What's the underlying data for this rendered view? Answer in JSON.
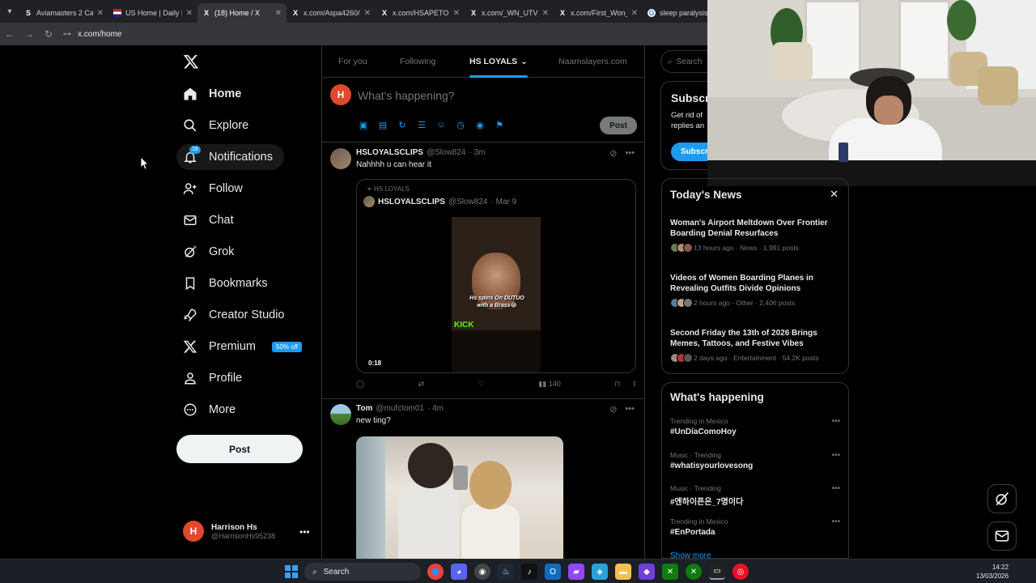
{
  "browser": {
    "tabs": [
      {
        "icon": "S",
        "title": "Aviamasters 2 Ca"
      },
      {
        "icon": "flag",
        "title": "US Home | Daily I"
      },
      {
        "icon": "X",
        "title": "(18) Home / X",
        "active": true
      },
      {
        "icon": "X",
        "title": "x.com/Aspa4260/"
      },
      {
        "icon": "X",
        "title": "x.com/HSAPETOI"
      },
      {
        "icon": "X",
        "title": "x.com/_WN_UTV_"
      },
      {
        "icon": "X",
        "title": "x.com/First_Won_"
      },
      {
        "icon": "G",
        "title": "sleep paralysis"
      }
    ],
    "url": "x.com/home"
  },
  "nav": {
    "items": [
      {
        "label": "Home",
        "icon": "home-icon"
      },
      {
        "label": "Explore",
        "icon": "search-icon"
      },
      {
        "label": "Notifications",
        "icon": "bell-icon",
        "badge": "18"
      },
      {
        "label": "Follow",
        "icon": "person-add-icon"
      },
      {
        "label": "Chat",
        "icon": "mail-icon"
      },
      {
        "label": "Grok",
        "icon": "grok-icon"
      },
      {
        "label": "Bookmarks",
        "icon": "bookmark-icon"
      },
      {
        "label": "Creator Studio",
        "icon": "rocket-icon"
      },
      {
        "label": "Premium",
        "icon": "x-icon",
        "promo": "50% off"
      },
      {
        "label": "Profile",
        "icon": "person-icon"
      },
      {
        "label": "More",
        "icon": "more-circle-icon"
      }
    ],
    "post_button": "Post",
    "account": {
      "name": "Harrison Hs",
      "handle": "@HarrisonHs95238",
      "initial": "H"
    }
  },
  "feed": {
    "tabs": [
      "For you",
      "Following",
      "HS LOYALS",
      "Naarnslayers.com"
    ],
    "active_tab": "HS LOYALS",
    "compose": {
      "placeholder": "What's happening?",
      "post_label": "Post",
      "initial": "H"
    },
    "tweets": [
      {
        "name": "HSLOYALSCLIPS",
        "handle": "@Slow824",
        "time": "· 3m",
        "text": "Nahhhh u can hear it",
        "quote": {
          "community": "HS LOYALS",
          "name": "HSLOYALSCLIPS",
          "handle": "@Slow824",
          "time": "· Mar 9",
          "video_caption": "Hs spins On DUTUO with a Brass😂",
          "video_brand": "KICK",
          "duration": "0:18"
        },
        "views": "140"
      },
      {
        "name": "Tom",
        "handle": "@mufctom01",
        "time": "· 4m",
        "text": "new ting?"
      }
    ]
  },
  "right": {
    "search_placeholder": "Search",
    "subscribe": {
      "title": "Subscri",
      "desc_line1": "Get rid of",
      "desc_line2": "replies an",
      "button": "Subscr"
    },
    "news": {
      "title": "Today's News",
      "items": [
        {
          "title": "Woman's Airport Meltdown Over Frontier Boarding Denial Resurfaces",
          "meta": "13 hours ago · News · 1,991 posts"
        },
        {
          "title": "Videos of Women Boarding Planes in Revealing Outfits Divide Opinions",
          "meta": "2 hours ago · Other · 2,406 posts"
        },
        {
          "title": "Second Friday the 13th of 2026 Brings Memes, Tattoos, and Festive Vibes",
          "meta": "2 days ago · Entertainment · 54.2K posts"
        }
      ]
    },
    "happening": {
      "title": "What's happening",
      "trends": [
        {
          "context": "Trending in Mexico",
          "name": "#UnDíaComoHoy"
        },
        {
          "context": "Music · Trending",
          "name": "#whatisyourlovesong"
        },
        {
          "context": "Music · Trending",
          "name": "#엔하이픈은_7명이다"
        },
        {
          "context": "Trending in Mexico",
          "name": "#EnPortada"
        }
      ],
      "show_more": "Show more"
    }
  },
  "taskbar": {
    "search": "Search",
    "time": "14:22",
    "date": "13/03/2026"
  },
  "colors": {
    "accent": "#1d9bf0",
    "background": "#000000",
    "avatar": "#e0492b",
    "kick": "#53fc18"
  }
}
